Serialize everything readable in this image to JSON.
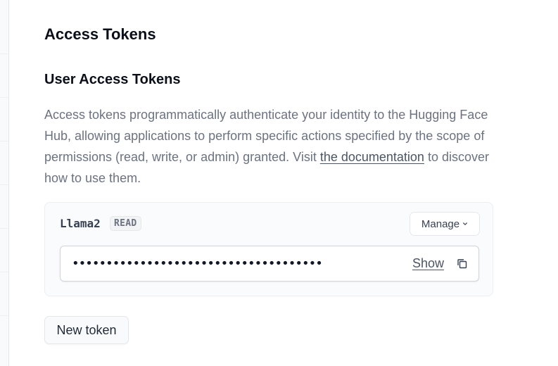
{
  "page": {
    "title": "Access Tokens"
  },
  "section": {
    "title": "User Access Tokens",
    "description_pre": "Access tokens programmatically authenticate your identity to the Hugging Face Hub, allowing applications to perform specific actions specified by the scope of permissions (read, write, or admin) granted. Visit ",
    "link_text": "the documentation",
    "description_post": " to discover how to use them."
  },
  "token": {
    "name": "Llama2",
    "role": "READ",
    "manage_label": "Manage",
    "masked_value": "•••••••••••••••••••••••••••••••••••••",
    "show_label": "Show"
  },
  "actions": {
    "new_token_label": "New token"
  },
  "icons": {
    "manage_dropdown": "chevron-down-icon",
    "copy": "copy-icon"
  }
}
